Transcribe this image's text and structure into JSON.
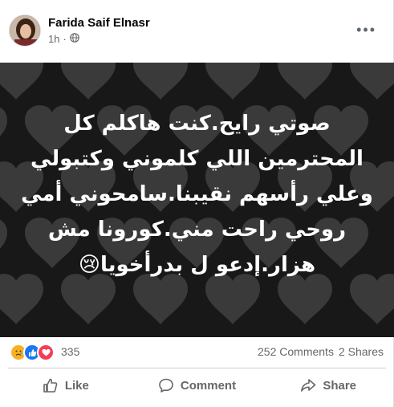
{
  "post": {
    "author": "Farida Saif Elnasr",
    "time": "1h",
    "visibility_icon": "globe-icon",
    "more_icon": "more-options-icon",
    "more_label": "•••"
  },
  "image_text": {
    "lines": [
      "صوتي رايح.كنت هاكلم كل",
      "المحترمين اللي كلموني وكتبولي",
      "وعلي رأسهم نقيبنا.سامحوني أمي",
      "روحي راحت مني.كورونا مش",
      "هزار.إدعو ل بدرأخويا😢"
    ]
  },
  "reactions": {
    "icons": [
      "sad-reaction-icon",
      "like-reaction-icon",
      "love-reaction-icon"
    ],
    "count": "335",
    "comments": "252 Comments",
    "shares": "2 Shares"
  },
  "actions": {
    "like": "Like",
    "comment": "Comment",
    "share": "Share"
  },
  "colors": {
    "image_background": "#181818",
    "heart_color": "#3a3a3a",
    "text_secondary": "#65676b",
    "like_blue": "#1877f2",
    "love_red": "#f33e58",
    "sad_yellow": "#f7b125"
  }
}
